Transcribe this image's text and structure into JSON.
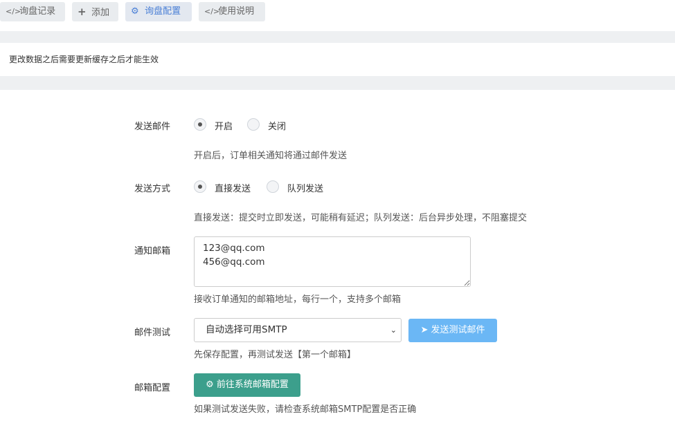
{
  "tabs": [
    {
      "label": "询盘记录",
      "icon": "code-icon"
    },
    {
      "label": "添加",
      "icon": "plus-icon"
    },
    {
      "label": "询盘配置",
      "icon": "gear-icon"
    },
    {
      "label": "使用说明",
      "icon": "code-icon"
    }
  ],
  "notice": "更改数据之后需要更新缓存之后才能生效",
  "send_mail": {
    "label": "发送邮件",
    "options": [
      "开启",
      "关闭"
    ],
    "selected": "开启",
    "help": "开启后，订单相关通知将通过邮件发送"
  },
  "send_mode": {
    "label": "发送方式",
    "options": [
      "直接发送",
      "队列发送"
    ],
    "selected": "直接发送",
    "help": "直接发送：提交时立即发送，可能稍有延迟；队列发送：后台异步处理，不阻塞提交"
  },
  "notify_mail": {
    "label": "通知邮箱",
    "value": "123@qq.com\n456@qq.com",
    "help": "接收订单通知的邮箱地址，每行一个，支持多个邮箱"
  },
  "mail_test": {
    "label": "邮件测试",
    "select_value": "自动选择可用SMTP",
    "button": "发送测试邮件",
    "help": "先保存配置，再测试发送【第一个邮箱】"
  },
  "mail_config": {
    "label": "邮箱配置",
    "button": "前往系统邮箱配置",
    "help": "如果测试发送失败，请检查系统邮箱SMTP配置是否正确"
  },
  "colors": {
    "accent": "#4a7fd6",
    "test_button": "#6bb7f5",
    "config_button": "#3c9f8c"
  }
}
